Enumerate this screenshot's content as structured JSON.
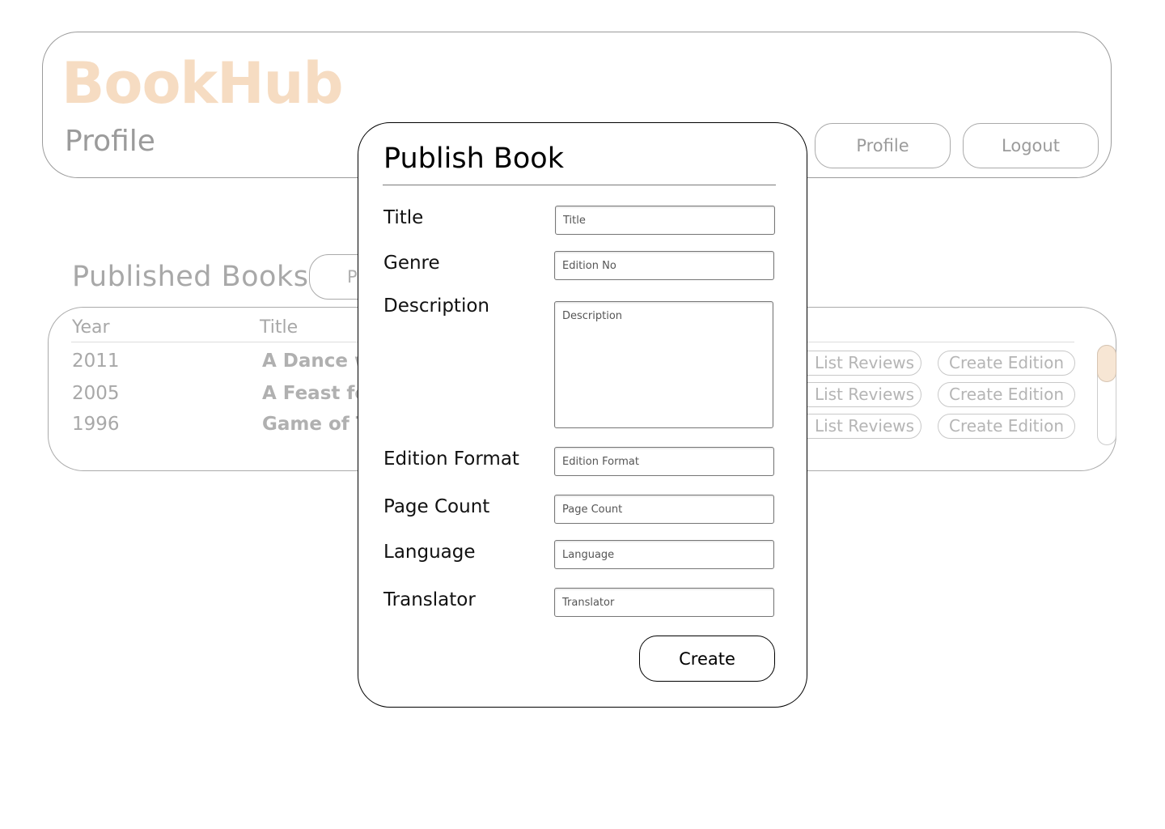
{
  "header": {
    "logo": "BookHub",
    "page_title": "Profile",
    "nav": {
      "profile_label": "Profile",
      "logout_label": "Logout"
    }
  },
  "books": {
    "section_title": "Published Books",
    "publish_button_partial": "P",
    "columns": {
      "year": "Year",
      "title": "Title"
    },
    "rows": [
      {
        "year": "2011",
        "title": "A Dance w",
        "list_reviews": "List Reviews",
        "create_edition": "Create Edition"
      },
      {
        "year": "2005",
        "title": "A Feast for",
        "list_reviews": "List Reviews",
        "create_edition": "Create Edition"
      },
      {
        "year": "1996",
        "title": "Game of T",
        "list_reviews": "List Reviews",
        "create_edition": "Create Edition"
      }
    ]
  },
  "modal": {
    "title": "Publish Book",
    "fields": {
      "title": {
        "label": "Title",
        "placeholder": "Title"
      },
      "genre": {
        "label": "Genre",
        "placeholder": "Edition No"
      },
      "description": {
        "label": "Description",
        "placeholder": "Description"
      },
      "edition_format": {
        "label": "Edition Format",
        "placeholder": "Edition Format"
      },
      "page_count": {
        "label": "Page Count",
        "placeholder": "Page Count"
      },
      "language": {
        "label": "Language",
        "placeholder": "Language"
      },
      "translator": {
        "label": "Translator",
        "placeholder": "Translator"
      }
    },
    "create_label": "Create"
  },
  "colors": {
    "brand": "#f6dcc2",
    "muted_text": "#a8a8a8",
    "scroll_thumb": "#f7e6d4"
  }
}
